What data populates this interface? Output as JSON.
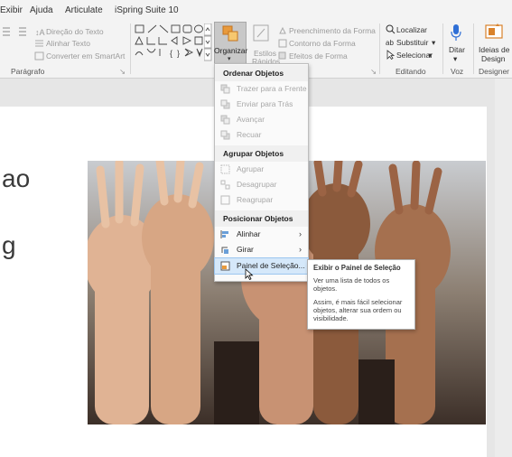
{
  "menubar": {
    "tabs": [
      "Exibir",
      "Ajuda",
      "Articulate",
      "iSpring Suite 10"
    ]
  },
  "ribbon": {
    "paragrafo": {
      "direcao_texto": "Direção do Texto",
      "alinhar_texto": "Alinhar Texto",
      "converter_smartart": "Converter em SmartArt",
      "label": "Parágrafo"
    },
    "organizar_label": "Organizar",
    "estilos_label_1": "Estilos",
    "estilos_label_2": "Rápidos",
    "forma": {
      "preenchimento": "Preenchimento da Forma",
      "contorno": "Contorno da Forma",
      "efeitos": "Efeitos de Forma"
    },
    "editando": {
      "localizar": "Localizar",
      "substituir": "Substituir",
      "selecionar": "Selecionar",
      "label": "Editando"
    },
    "voz": {
      "ditar": "Ditar",
      "label": "Voz"
    },
    "designer": {
      "ideias_1": "Ideias de",
      "ideias_2": "Design",
      "label": "Designer"
    }
  },
  "slide": {
    "text_line_1": "ao",
    "text_line_2": "g"
  },
  "dropdown": {
    "sections": [
      {
        "header": "Ordenar Objetos",
        "items": [
          {
            "label": "Trazer para a Frente",
            "enabled": false,
            "arrow": false
          },
          {
            "label": "Enviar para Trás",
            "enabled": false,
            "arrow": false
          },
          {
            "label": "Avançar",
            "enabled": false,
            "arrow": false
          },
          {
            "label": "Recuar",
            "enabled": false,
            "arrow": false
          }
        ]
      },
      {
        "header": "Agrupar Objetos",
        "items": [
          {
            "label": "Agrupar",
            "enabled": false,
            "arrow": false
          },
          {
            "label": "Desagrupar",
            "enabled": false,
            "arrow": false
          },
          {
            "label": "Reagrupar",
            "enabled": false,
            "arrow": false
          }
        ]
      },
      {
        "header": "Posicionar Objetos",
        "items": [
          {
            "label": "Alinhar",
            "enabled": true,
            "arrow": true
          },
          {
            "label": "Girar",
            "enabled": true,
            "arrow": true
          },
          {
            "label": "Painel de Seleção...",
            "enabled": true,
            "arrow": false,
            "hover": true
          }
        ]
      }
    ]
  },
  "tooltip": {
    "title": "Exibir o Painel de Seleção",
    "line1": "Ver uma lista de todos os objetos.",
    "line2": "Assim, é mais fácil selecionar objetos, alterar sua ordem ou visibilidade."
  },
  "colors": {
    "hover_bg": "#d5e8fa",
    "organizar_active_bg": "#c8c8c8",
    "accent_orange": "#d9822b",
    "ditar_blue": "#2f6fd6"
  },
  "icons": {
    "organizar": "arrange-icon",
    "estilos": "quick-styles-icon",
    "localizar": "search-icon",
    "substituir": "replace-icon",
    "selecionar": "select-cursor-icon",
    "ditar": "microphone-icon",
    "ideias": "design-ideas-icon",
    "painel": "selection-pane-icon"
  }
}
